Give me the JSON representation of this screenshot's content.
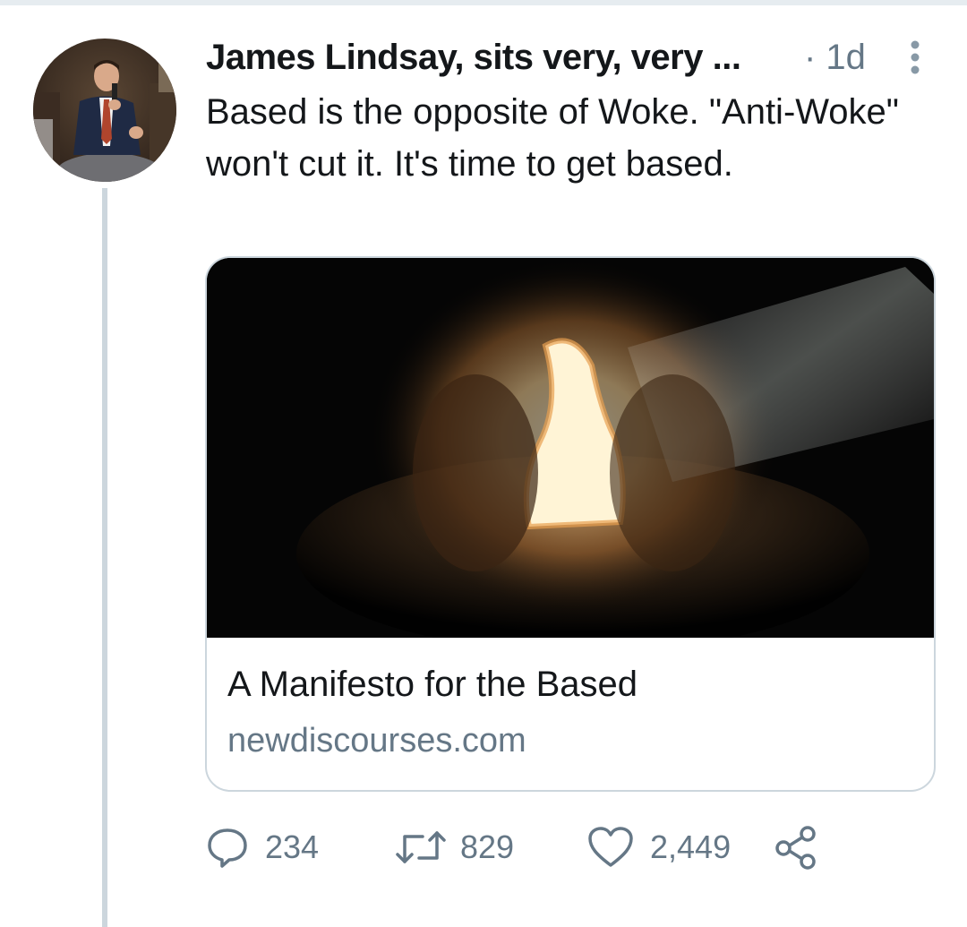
{
  "tweet": {
    "author_name": "James Lindsay, sits very, very ...",
    "timestamp": "· 1d",
    "text": "Based is the opposite of Woke. \"Anti-Woke\" won't cut it. It's time to get based."
  },
  "card": {
    "title": "A Manifesto for the Based",
    "domain": "newdiscourses.com"
  },
  "actions": {
    "replies": "234",
    "retweets": "829",
    "likes": "2,449"
  },
  "icons": {
    "reply": "reply-icon",
    "retweet": "retweet-icon",
    "like": "heart-icon",
    "share": "share-icon",
    "more": "more-vertical-icon"
  },
  "colors": {
    "text_primary": "#14171a",
    "text_secondary": "#657786",
    "border": "#ccd6dd"
  }
}
